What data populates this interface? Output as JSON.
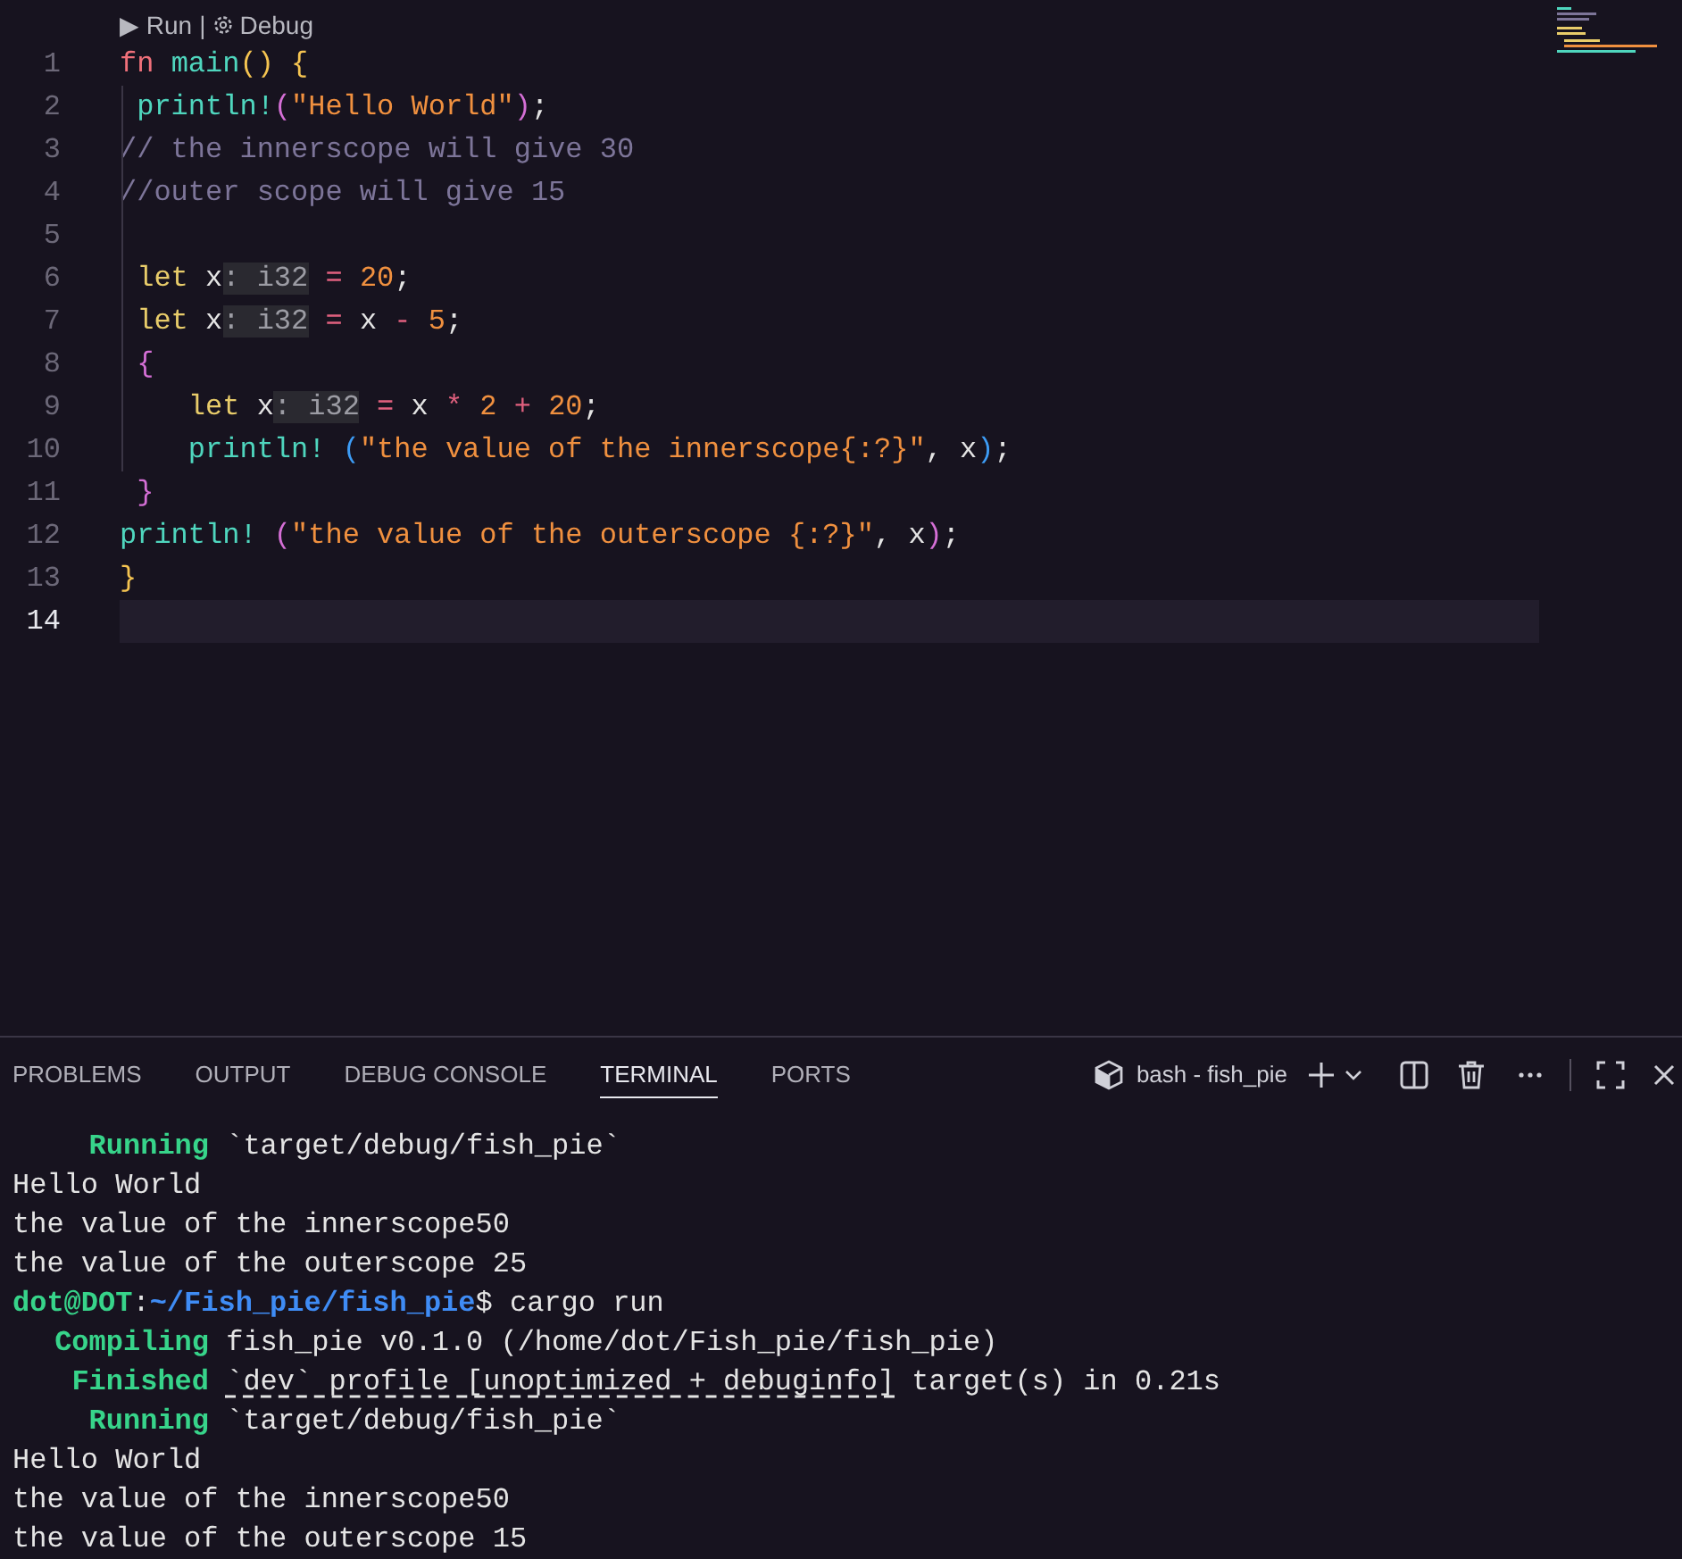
{
  "editor": {
    "codelens": {
      "run": "▶ Run",
      "separator": "|",
      "debug": "Debug"
    },
    "lines": [
      {
        "number": "1",
        "current": false,
        "tokens": [
          {
            "kind": "keyword",
            "text": "fn "
          },
          {
            "kind": "function",
            "text": "main"
          },
          {
            "kind": "bracket1",
            "text": "() {"
          }
        ]
      },
      {
        "number": "2",
        "current": false,
        "tokens": [
          {
            "kind": "macro",
            "text": " println!"
          },
          {
            "kind": "bracket2",
            "text": "("
          },
          {
            "kind": "string",
            "text": "\"Hello World\""
          },
          {
            "kind": "bracket2",
            "text": ")"
          },
          {
            "kind": "plain",
            "text": ";"
          }
        ]
      },
      {
        "number": "3",
        "current": false,
        "tokens": [
          {
            "kind": "comment",
            "text": "// the innerscope will give 30"
          }
        ]
      },
      {
        "number": "4",
        "current": false,
        "tokens": [
          {
            "kind": "comment",
            "text": "//outer scope will give 15"
          }
        ]
      },
      {
        "number": "5",
        "current": false
      },
      {
        "number": "6",
        "current": false,
        "tokens": [
          {
            "kind": "let",
            "text": " let "
          },
          {
            "kind": "plain",
            "text": "x"
          },
          {
            "kind": "hint",
            "text": ": i32"
          },
          {
            "kind": "operator",
            "text": " = "
          },
          {
            "kind": "number",
            "text": "20"
          },
          {
            "kind": "plain",
            "text": ";"
          }
        ]
      },
      {
        "number": "7",
        "current": false,
        "tokens": [
          {
            "kind": "let",
            "text": " let "
          },
          {
            "kind": "plain",
            "text": "x"
          },
          {
            "kind": "hint",
            "text": ": i32"
          },
          {
            "kind": "operator",
            "text": " = "
          },
          {
            "kind": "plain",
            "text": "x "
          },
          {
            "kind": "operator",
            "text": "- "
          },
          {
            "kind": "number",
            "text": "5"
          },
          {
            "kind": "plain",
            "text": ";"
          }
        ]
      },
      {
        "number": "8",
        "current": false,
        "tokens": [
          {
            "kind": "bracket2",
            "text": " {"
          }
        ]
      },
      {
        "number": "9",
        "current": false,
        "tokens": [
          {
            "kind": "let",
            "text": "    let "
          },
          {
            "kind": "plain",
            "text": "x"
          },
          {
            "kind": "hint",
            "text": ": i32"
          },
          {
            "kind": "operator",
            "text": " = "
          },
          {
            "kind": "plain",
            "text": "x "
          },
          {
            "kind": "operator",
            "text": "* "
          },
          {
            "kind": "number",
            "text": "2 "
          },
          {
            "kind": "operator",
            "text": "+ "
          },
          {
            "kind": "number",
            "text": "20"
          },
          {
            "kind": "plain",
            "text": ";"
          }
        ]
      },
      {
        "number": "10",
        "current": false,
        "tokens": [
          {
            "kind": "macro",
            "text": "    println! "
          },
          {
            "kind": "bracket3",
            "text": "("
          },
          {
            "kind": "string",
            "text": "\"the value of the innerscope{:?}\""
          },
          {
            "kind": "plain",
            "text": ", x"
          },
          {
            "kind": "bracket3",
            "text": ")"
          },
          {
            "kind": "plain",
            "text": ";"
          }
        ]
      },
      {
        "number": "11",
        "current": false,
        "tokens": [
          {
            "kind": "bracket2",
            "text": " }"
          }
        ]
      },
      {
        "number": "12",
        "current": false,
        "tokens": [
          {
            "kind": "macro",
            "text": "println! "
          },
          {
            "kind": "bracket2",
            "text": "("
          },
          {
            "kind": "string",
            "text": "\"the value of the outerscope {:?}\""
          },
          {
            "kind": "plain",
            "text": ", x"
          },
          {
            "kind": "bracket2",
            "text": ")"
          },
          {
            "kind": "plain",
            "text": ";"
          }
        ]
      },
      {
        "number": "13",
        "current": false,
        "tokens": [
          {
            "kind": "bracket1",
            "text": "}"
          }
        ]
      },
      {
        "number": "14",
        "current": true
      }
    ]
  },
  "panel": {
    "tabs": [
      {
        "label": "PROBLEMS",
        "selected": false
      },
      {
        "label": "OUTPUT",
        "selected": false
      },
      {
        "label": "DEBUG CONSOLE",
        "selected": false
      },
      {
        "label": "TERMINAL",
        "selected": true
      },
      {
        "label": "PORTS",
        "selected": false
      }
    ],
    "terminal_name": "bash - fish_pie",
    "terminal": [
      {
        "segments": [
          {
            "kind": "status",
            "text": "Running"
          },
          {
            "kind": "text",
            "text": "`target/debug/fish_pie`"
          }
        ]
      },
      {
        "segments": [
          {
            "kind": "text",
            "text": "Hello World"
          }
        ]
      },
      {
        "segments": [
          {
            "kind": "text",
            "text": "the value of the innerscope50"
          }
        ]
      },
      {
        "segments": [
          {
            "kind": "text",
            "text": "the value of the outerscope 25"
          }
        ]
      },
      {
        "segments": [
          {
            "kind": "user",
            "text": "dot@DOT"
          },
          {
            "kind": "text",
            "text": ":"
          },
          {
            "kind": "path",
            "text": "~/Fish_pie/fish_pie"
          },
          {
            "kind": "text",
            "text": "$ cargo run"
          }
        ]
      },
      {
        "segments": [
          {
            "kind": "status",
            "text": "Compiling"
          },
          {
            "kind": "text",
            "text": "fish_pie v0.1.0 (/home/dot/Fish_pie/fish_pie)"
          }
        ]
      },
      {
        "segments": [
          {
            "kind": "status",
            "text": "Finished"
          },
          {
            "kind": "link",
            "text": "`dev` profile [unoptimized + debuginfo]"
          },
          {
            "kind": "text",
            "text": " target(s) in 0.21s"
          }
        ]
      },
      {
        "segments": [
          {
            "kind": "status",
            "text": "Running"
          },
          {
            "kind": "text",
            "text": "`target/debug/fish_pie`"
          }
        ]
      },
      {
        "segments": [
          {
            "kind": "text",
            "text": "Hello World"
          }
        ]
      },
      {
        "segments": [
          {
            "kind": "text",
            "text": "the value of the innerscope50"
          }
        ]
      },
      {
        "segments": [
          {
            "kind": "text",
            "text": "the value of the outerscope 15"
          }
        ]
      }
    ]
  }
}
